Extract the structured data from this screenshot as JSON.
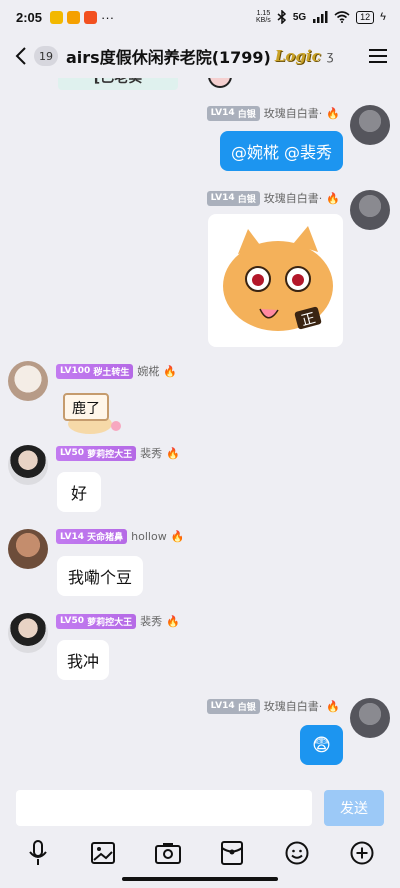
{
  "status": {
    "time": "2:05",
    "more": "···",
    "net_speed": "1.15",
    "net_unit": "KB/s",
    "signal": "5G",
    "battery": "12"
  },
  "header": {
    "unread": "19",
    "title": "airs度假休闲养老院(1799)",
    "brand": "Logic",
    "ear_symbol": "ʒ"
  },
  "messages": [
    {
      "side": "right",
      "level": "LV14",
      "title": "白银",
      "name": "玫瑰自白書·",
      "text": "@婉椛 @裴秀"
    },
    {
      "side": "right",
      "level": "LV14",
      "title": "白银",
      "name": "玫瑰自白書·",
      "sticker": "cat-sticker",
      "sticker_text": "正"
    },
    {
      "side": "left",
      "level": "LV100",
      "title": "秽土转生",
      "name": "婉椛",
      "sticker": "deer-sticker",
      "sticker_text": "鹿了"
    },
    {
      "side": "left",
      "level": "LV50",
      "title": "萝莉控大王",
      "name": "裴秀",
      "text": "好"
    },
    {
      "side": "left",
      "level": "LV14",
      "title": "天命猪鼻",
      "name": "hollow",
      "text": "我嘞个豆"
    },
    {
      "side": "left",
      "level": "LV50",
      "title": "萝莉控大王",
      "name": "裴秀",
      "text": "我冲"
    },
    {
      "side": "right",
      "level": "LV14",
      "title": "白银",
      "name": "玫瑰自白書·",
      "text": "😨"
    }
  ],
  "partial_top": {
    "text": "[已老实"
  },
  "input": {
    "placeholder": "",
    "value": "",
    "send_label": "发送"
  },
  "colors": {
    "blue_bubble": "#1c95f0",
    "send_disabled": "#9cc9f7",
    "background": "#eeeef3"
  }
}
